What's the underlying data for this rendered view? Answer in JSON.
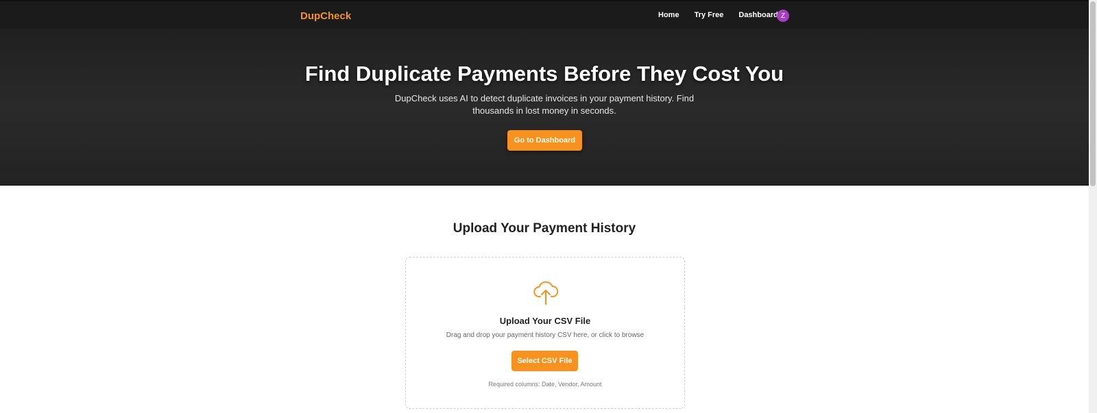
{
  "nav": {
    "brand": "DupCheck",
    "links": [
      {
        "label": "Home"
      },
      {
        "label": "Try Free"
      },
      {
        "label": "Dashboard"
      }
    ],
    "avatar_initial": "Z"
  },
  "hero": {
    "title": "Find Duplicate Payments Before They Cost You",
    "subtitle": "DupCheck uses AI to detect duplicate invoices in your payment history. Find thousands in lost money in seconds.",
    "cta": "Go to Dashboard"
  },
  "upload": {
    "section_title": "Upload Your Payment History",
    "icon": "cloud-upload-icon",
    "title": "Upload Your CSV File",
    "description": "Drag and drop your payment history CSV here, or click to browse",
    "button": "Select CSV File",
    "note": "Required columns: Date, Vendor, Amount"
  },
  "colors": {
    "accent": "#f7921e",
    "nav_bg": "#1b1b1b",
    "avatar": "#a43fbf"
  }
}
